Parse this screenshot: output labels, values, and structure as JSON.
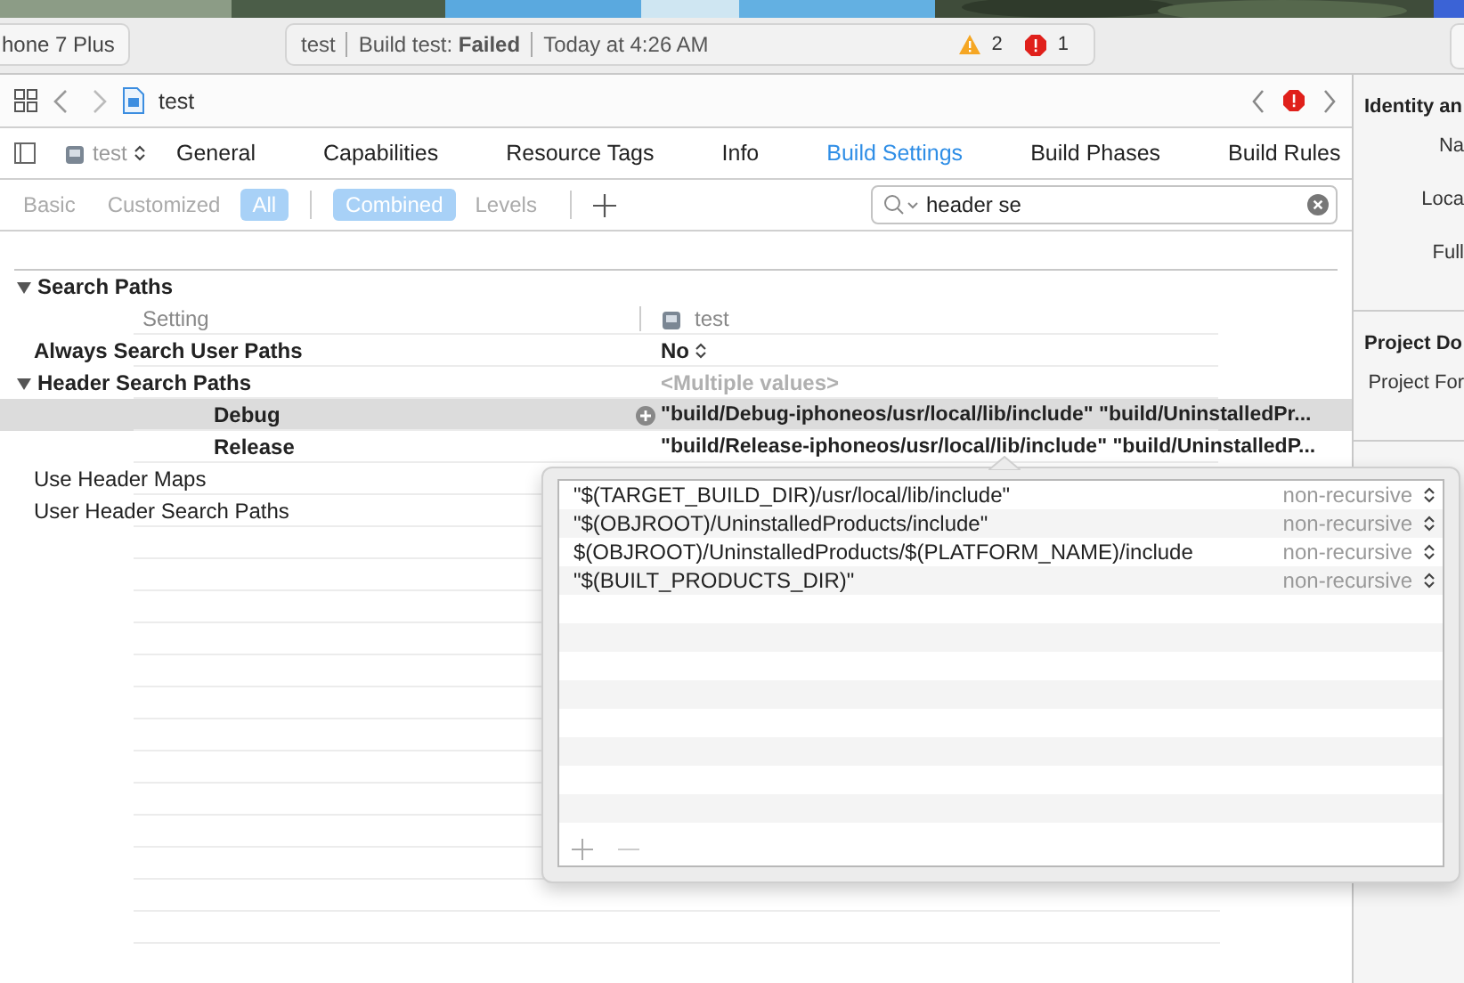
{
  "toolbar": {
    "scheme": "hone 7 Plus",
    "activity": {
      "project": "test",
      "status": "Build test: **Failed**",
      "time": "Today at 4:26 AM",
      "warnings": "2",
      "errors": "1"
    }
  },
  "jump_bar": {
    "file": "test"
  },
  "tab_bar": {
    "target": "test",
    "tabs": [
      {
        "label": "General",
        "selected": false
      },
      {
        "label": "Capabilities",
        "selected": false
      },
      {
        "label": "Resource Tags",
        "selected": false
      },
      {
        "label": "Info",
        "selected": false
      },
      {
        "label": "Build Settings",
        "selected": true
      },
      {
        "label": "Build Phases",
        "selected": false
      },
      {
        "label": "Build Rules",
        "selected": false
      }
    ]
  },
  "filter_bar": {
    "scopes": [
      {
        "label": "Basic",
        "selected": false
      },
      {
        "label": "Customized",
        "selected": false
      },
      {
        "label": "All",
        "selected": true
      }
    ],
    "views": [
      {
        "label": "Combined",
        "selected": true
      },
      {
        "label": "Levels",
        "selected": false
      }
    ],
    "search": {
      "value": "header se"
    }
  },
  "settings": {
    "section": "Search Paths",
    "expanded": true,
    "columns": {
      "setting": "Setting",
      "target": "test"
    },
    "rows": [
      {
        "name": "Always Search User Paths",
        "value": "No",
        "bold": true,
        "popup": true,
        "dimmed": false
      },
      {
        "name": "Header Search Paths",
        "value": "<Multiple values>",
        "bold": true,
        "popup": false,
        "dimmed": true,
        "expanded": true,
        "children": [
          {
            "name": "Debug",
            "value": "\"build/Debug-iphoneos/usr/local/lib/include\" \"build/UninstalledPr...",
            "selected": true
          },
          {
            "name": "Release",
            "value": "\"build/Release-iphoneos/usr/local/lib/include\" \"build/UninstalledP...",
            "selected": false
          }
        ]
      },
      {
        "name": "Use Header Maps",
        "bold": false
      },
      {
        "name": "User Header Search Paths",
        "bold": false
      }
    ]
  },
  "path_popover": {
    "paths": [
      {
        "path": "\"$(TARGET_BUILD_DIR)/usr/local/lib/include\"",
        "recursion": "non-recursive"
      },
      {
        "path": "\"$(OBJROOT)/UninstalledProducts/include\"",
        "recursion": "non-recursive"
      },
      {
        "path": "$(OBJROOT)/UninstalledProducts/$(PLATFORM_NAME)/include",
        "recursion": "non-recursive"
      },
      {
        "path": "\"$(BUILT_PRODUCTS_DIR)\"",
        "recursion": "non-recursive"
      }
    ]
  },
  "inspector": {
    "sections": [
      {
        "title": "Identity an",
        "fields": [
          "Na",
          "Loca",
          "Full"
        ]
      },
      {
        "title": "Project Do",
        "fields": [
          "Project For"
        ]
      }
    ]
  }
}
